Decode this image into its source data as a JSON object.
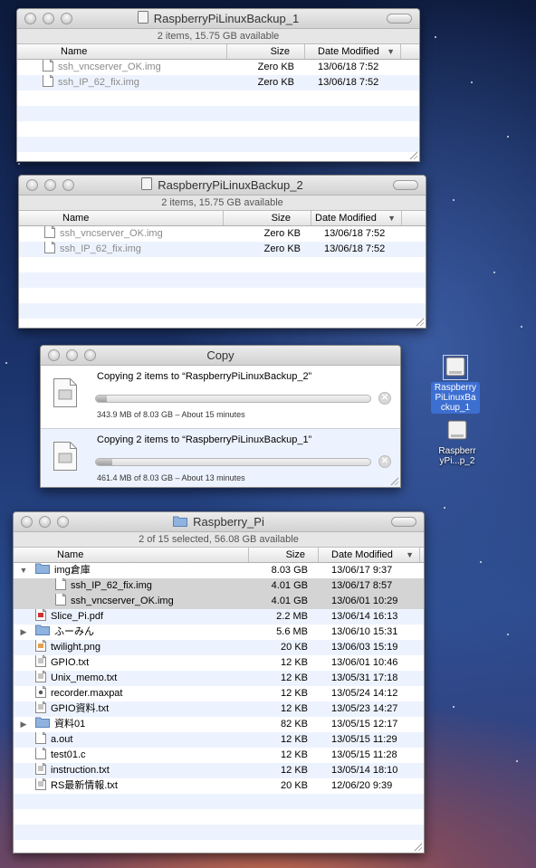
{
  "window_backup1": {
    "title": "RaspberryPiLinuxBackup_1",
    "status": "2 items, 15.75 GB available",
    "columns": {
      "name": "Name",
      "size": "Size",
      "date": "Date Modified"
    },
    "rows": [
      {
        "name": "ssh_vncserver_OK.img",
        "size": "Zero KB",
        "date": "13/06/18 7:52"
      },
      {
        "name": "ssh_IP_62_fix.img",
        "size": "Zero KB",
        "date": "13/06/18 7:52"
      }
    ]
  },
  "window_backup2": {
    "title": "RaspberryPiLinuxBackup_2",
    "status": "2 items, 15.75 GB available",
    "columns": {
      "name": "Name",
      "size": "Size",
      "date": "Date Modified"
    },
    "rows": [
      {
        "name": "ssh_vncserver_OK.img",
        "size": "Zero KB",
        "date": "13/06/18 7:52"
      },
      {
        "name": "ssh_IP_62_fix.img",
        "size": "Zero KB",
        "date": "13/06/18 7:52"
      }
    ]
  },
  "copy_window": {
    "title": "Copy",
    "items": [
      {
        "text": "Copying 2 items to “RaspberryPiLinuxBackup_2”",
        "detail": "343.9 MB of 8.03 GB – About 15 minutes",
        "progress": 0.04
      },
      {
        "text": "Copying 2 items to “RaspberryPiLinuxBackup_1”",
        "detail": "461.4 MB of 8.03 GB – About 13 minutes",
        "progress": 0.06
      }
    ]
  },
  "window_pi": {
    "title": "Raspberry_Pi",
    "status": "2 of 15 selected, 56.08 GB available",
    "columns": {
      "name": "Name",
      "size": "Size",
      "date": "Date Modified"
    },
    "rows": [
      {
        "name": "img倉庫",
        "size": "8.03 GB",
        "date": "13/06/17 9:37",
        "kind": "folder",
        "disclosure": "▼"
      },
      {
        "name": "ssh_IP_62_fix.img",
        "size": "4.01 GB",
        "date": "13/06/17 8:57",
        "kind": "doc",
        "indent": true,
        "selected": true
      },
      {
        "name": "ssh_vncserver_OK.img",
        "size": "4.01 GB",
        "date": "13/06/01 10:29",
        "kind": "doc",
        "indent": true,
        "selected": true
      },
      {
        "name": "Slice_Pi.pdf",
        "size": "2.2 MB",
        "date": "13/06/14 16:13",
        "kind": "pdf"
      },
      {
        "name": "ふーみん",
        "size": "5.6 MB",
        "date": "13/06/10 15:31",
        "kind": "folder",
        "disclosure": "▶"
      },
      {
        "name": "twilight.png",
        "size": "20 KB",
        "date": "13/06/03 15:19",
        "kind": "image"
      },
      {
        "name": "GPIO.txt",
        "size": "12 KB",
        "date": "13/06/01 10:46",
        "kind": "text"
      },
      {
        "name": "Unix_memo.txt",
        "size": "12 KB",
        "date": "13/05/31 17:18",
        "kind": "text"
      },
      {
        "name": "recorder.maxpat",
        "size": "12 KB",
        "date": "13/05/24 14:12",
        "kind": "patch"
      },
      {
        "name": "GPIO資料.txt",
        "size": "12 KB",
        "date": "13/05/23 14:27",
        "kind": "text"
      },
      {
        "name": "資料01",
        "size": "82 KB",
        "date": "13/05/15 12:17",
        "kind": "folder",
        "disclosure": "▶"
      },
      {
        "name": "a.out",
        "size": "12 KB",
        "date": "13/05/15 11:29",
        "kind": "doc"
      },
      {
        "name": "test01.c",
        "size": "12 KB",
        "date": "13/05/15 11:28",
        "kind": "doc"
      },
      {
        "name": "instruction.txt",
        "size": "12 KB",
        "date": "13/05/14 18:10",
        "kind": "text"
      },
      {
        "name": "RS最新情報.txt",
        "size": "20 KB",
        "date": "12/06/20 9:39",
        "kind": "text"
      }
    ]
  },
  "desktop_icons": [
    {
      "label": "Raspberry PiLinuxBa ckup_1",
      "selected": true
    },
    {
      "label": "Raspberr yPi...p_2",
      "selected": false
    }
  ],
  "colors": {
    "selection": "#3d6fd1",
    "stripe": "#edf3fe",
    "selected_row": "#d4d4d4"
  }
}
